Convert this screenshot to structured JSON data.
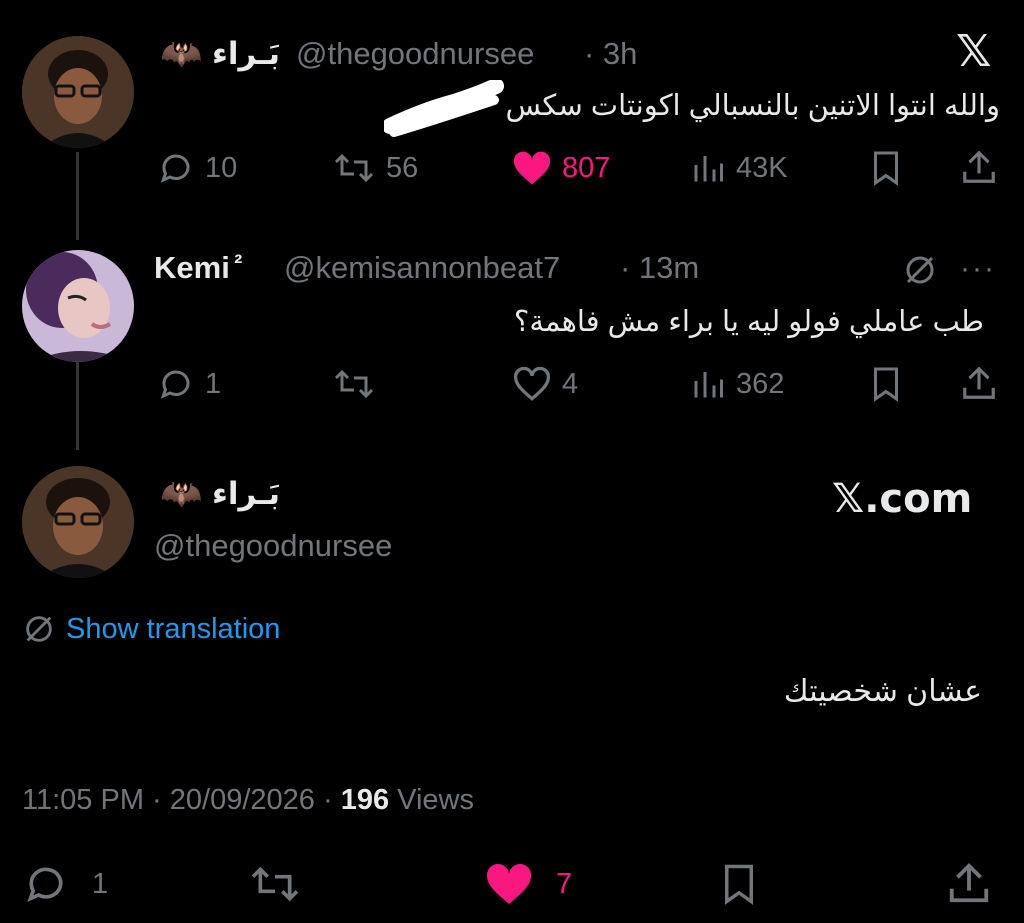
{
  "tweet1": {
    "display_name": "بَـراء",
    "handle": "@thegoodnursee",
    "time": "· 3h",
    "text": "والله انتوا الاتنين بالنسبالي اكونتات سكس",
    "replies": "10",
    "retweets": "56",
    "likes": "807",
    "views": "43K"
  },
  "tweet2": {
    "display_name": "Kemi",
    "name_suffix": "²",
    "handle": "@kemisannonbeat7",
    "time": "· 13m",
    "text": "طب عاملي فولو ليه يا براء مش فاهمة؟",
    "replies": "1",
    "likes": "4",
    "views": "362"
  },
  "tweet3": {
    "display_name": "بَـراء",
    "handle": "@thegoodnursee",
    "watermark": "𝕏.com",
    "show_translation": "Show translation",
    "text": "عشان شخصيتك",
    "time": "11:05 PM",
    "date": "· 20/09/2026 ·",
    "views_count": "196",
    "views_label": "Views",
    "replies": "1",
    "likes": "7"
  },
  "colors": {
    "background": "#000000",
    "text": "#e7e9ea",
    "muted": "#71767b",
    "like": "#f91880",
    "link": "#1d9bf0"
  }
}
